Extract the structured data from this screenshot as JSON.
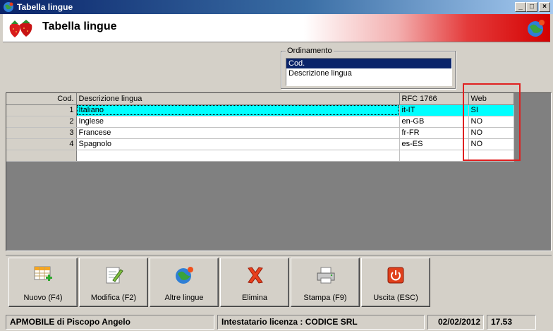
{
  "window": {
    "title": "Tabella lingue"
  },
  "header": {
    "title": "Tabella lingue"
  },
  "sort": {
    "legend": "Ordinamento",
    "options": [
      "Cod.",
      "Descrizione lingua"
    ],
    "selected_index": 0
  },
  "grid": {
    "columns": [
      "Cod.",
      "Descrizione lingua",
      "RFC 1766",
      "Web"
    ],
    "rows": [
      {
        "cod": "1",
        "descrizione": "Italiano",
        "rfc": "it-IT",
        "web": "SI"
      },
      {
        "cod": "2",
        "descrizione": "Inglese",
        "rfc": "en-GB",
        "web": "NO"
      },
      {
        "cod": "3",
        "descrizione": "Francese",
        "rfc": "fr-FR",
        "web": "NO"
      },
      {
        "cod": "4",
        "descrizione": "Spagnolo",
        "rfc": "es-ES",
        "web": "NO"
      }
    ],
    "current_row": 0
  },
  "toolbar": {
    "nuovo": "Nuovo (F4)",
    "modifica": "Modifica (F2)",
    "altre_lingue": "Altre lingue",
    "elimina": "Elimina",
    "stampa": "Stampa (F9)",
    "uscita": "Uscita (ESC)"
  },
  "status": {
    "company": "APMOBILE di Piscopo Angelo",
    "license": "Intestatario licenza : CODICE SRL",
    "date": "02/02/2012",
    "time": "17.53"
  },
  "colors": {
    "title_bar": "#0a246a",
    "selection": "#0a246a",
    "current_row": "#00ffff",
    "highlight_box": "#e02020",
    "header_red": "#d40000"
  }
}
